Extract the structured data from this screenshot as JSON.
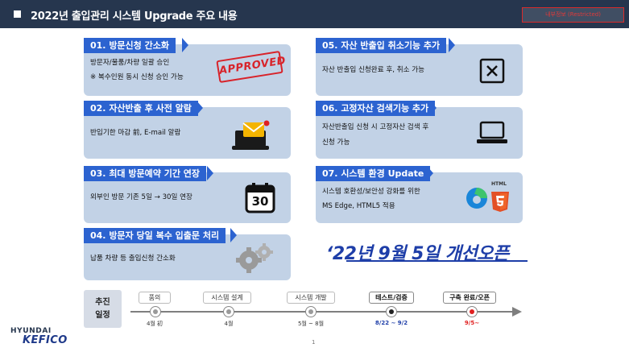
{
  "header": {
    "title": "2022년 출입관리 시스템 Upgrade 주요 내용",
    "stamp": "내부정보 (Restricted)"
  },
  "cards": {
    "c1": {
      "title": "01. 방문신청 간소화",
      "line1": "방문자/물품/차량 일괄 승인",
      "line2": "※ 복수인원 동시 신청 승인 가능",
      "stamp": "APPROVED"
    },
    "c2": {
      "title": "02. 자산반출 후 사전 알람",
      "line1": "반입기한 마감 前, E-mail 알람"
    },
    "c3": {
      "title": "03. 최대 방문예약 기간 연장",
      "line1": "외부인 방문 기존 5일 → 30일 연장",
      "calendar": "30"
    },
    "c4": {
      "title": "04. 방문자 당일 복수 입출문 처리",
      "line1": "납품 차량 등 출입신청 간소화"
    },
    "c5": {
      "title": "05. 자산 반출입 취소기능 추가",
      "line1": "자산 반출입 신청완료 후, 취소 가능"
    },
    "c6": {
      "title": "06. 고정자산 검색기능 추가",
      "line1": "자산반출입 신청 시 고정자산 검색 후",
      "line2": "신청 가능"
    },
    "c7": {
      "title": "07. 시스템 환경 Update",
      "line1": "시스템 호환성/보안성 강화를 위한",
      "line2": "MS Edge, HTML5 적용",
      "html_label": "HTML"
    }
  },
  "open_text": "‘22년 9월 5일 개선오픈",
  "schedule": {
    "label_line1": "추진",
    "label_line2": "일정",
    "stages": [
      {
        "name": "품의",
        "date": "4월 初"
      },
      {
        "name": "시스템 설계",
        "date": "4월"
      },
      {
        "name": "시스템 개발",
        "date": "5월 ~ 8월"
      },
      {
        "name": "테스트/검증",
        "date": "8/22 ~ 9/2"
      },
      {
        "name": "구축 완료/오픈",
        "date": "9/5~"
      }
    ]
  },
  "logo": {
    "top": "HYUNDAI",
    "bottom": "KEFICO"
  },
  "page_number": "1",
  "colors": {
    "header_bg": "#26364e",
    "card_bg": "#c2d2e6",
    "card_title_bg": "#2c63d0",
    "open_text": "#1e3ea8",
    "stamp_red": "#d8232a",
    "accent_red": "#e02020"
  }
}
